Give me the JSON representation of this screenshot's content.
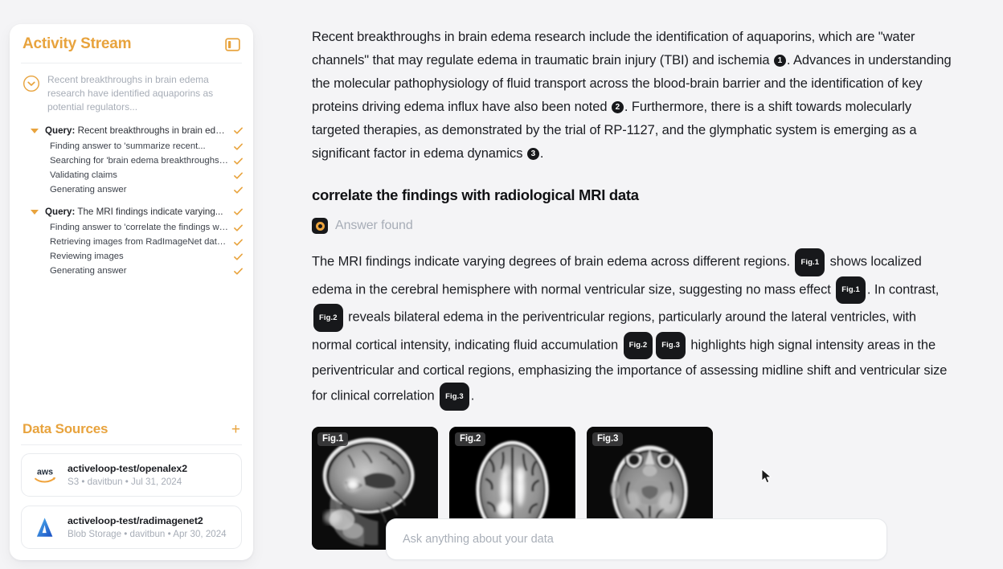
{
  "sidebar": {
    "activity": {
      "title": "Activity Stream",
      "panel_icon": "panel-collapse-icon",
      "summary": "Recent breakthroughs in brain edema research have identified aquaporins as potential regulators...",
      "groups": [
        {
          "label_prefix": "Query:",
          "label": "Recent breakthroughs in brain edem...",
          "status": "done",
          "steps": [
            {
              "label": "Finding answer to 'summarize recent...",
              "status": "done"
            },
            {
              "label": "Searching for 'brain edema breakthroughs' i...",
              "status": "done"
            },
            {
              "label": "Validating claims",
              "status": "done"
            },
            {
              "label": "Generating answer",
              "status": "done"
            }
          ]
        },
        {
          "label_prefix": "Query:",
          "label": "The MRI findings indicate varying...",
          "status": "done",
          "steps": [
            {
              "label": "Finding answer to 'correlate the findings wit...",
              "status": "done"
            },
            {
              "label": "Retrieving images from RadImageNet dataset",
              "status": "done"
            },
            {
              "label": "Reviewing images",
              "status": "done"
            },
            {
              "label": "Generating answer",
              "status": "done"
            }
          ]
        }
      ]
    },
    "data_sources": {
      "title": "Data Sources",
      "add_label": "+",
      "items": [
        {
          "logo": "aws-icon",
          "name": "activeloop-test/openalex2",
          "subtitle": "S3 • davitbun • Jul 31, 2024"
        },
        {
          "logo": "azure-icon",
          "name": "activeloop-test/radimagenet2",
          "subtitle": "Blob Storage • davitbun • Apr 30, 2024"
        }
      ]
    }
  },
  "main": {
    "intro": {
      "p1a": "Recent breakthroughs in brain edema research include the identification of aquaporins, which are \"water channels\" that may regulate edema in traumatic brain injury (TBI) and ischemia ",
      "ref1": "1",
      "p1b": ". Advances in understanding the molecular pathophysiology of fluid transport across the blood-brain barrier and the identification of key proteins driving edema influx have also been noted ",
      "ref2": "2",
      "p1c": ". Furthermore, there is a shift towards molecularly targeted therapies, as demonstrated by the trial of RP-1127, and the glymphatic system is emerging as a significant factor in edema dynamics ",
      "ref3": "3",
      "p1d": "."
    },
    "question": "correlate the findings with radiological MRI data",
    "status": {
      "icon": "answer-found-icon",
      "label": "Answer found"
    },
    "answer": {
      "t0": "The MRI findings indicate varying degrees of brain edema across different regions. ",
      "b1": "Fig.1",
      "t1": " shows localized edema in the cerebral hemisphere with normal ventricular size, suggesting no mass effect ",
      "b2": "Fig.1",
      "t2": ". In contrast, ",
      "b3": "Fig.2",
      "t3": " reveals bilateral edema in the periventricular regions, particularly around the lateral ventricles, with normal cortical intensity, indicating fluid accumulation ",
      "b4": "Fig.2",
      "b5": "Fig.3",
      "t4": " highlights high signal intensity areas in the periventricular and cortical regions, emphasizing the importance of assessing midline shift and ventricular size for clinical correlation ",
      "b6": "Fig.3",
      "t5": "."
    },
    "figures": [
      {
        "tag": "Fig.1",
        "view": "sagittal-mri"
      },
      {
        "tag": "Fig.2",
        "view": "axial-mri-ventricles"
      },
      {
        "tag": "Fig.3",
        "view": "axial-mri-skullbase"
      }
    ],
    "composer": {
      "placeholder": "Ask anything about your data",
      "value": ""
    }
  },
  "colors": {
    "accent": "#e8a33d",
    "badge": "#17181b",
    "muted": "#a7adb7",
    "page_bg": "#f4f4f6"
  }
}
